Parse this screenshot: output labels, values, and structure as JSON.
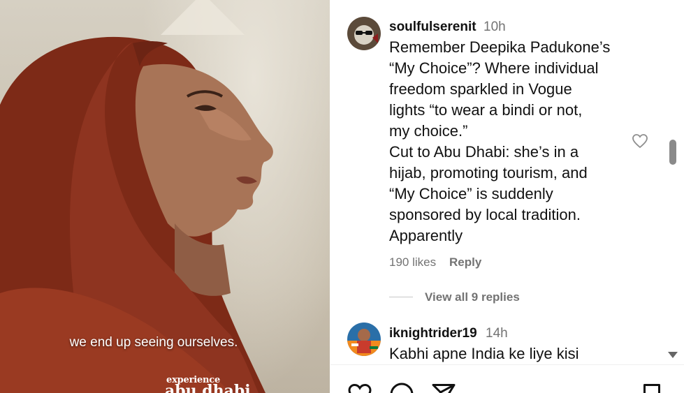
{
  "video": {
    "subtitle": "we end up seeing ourselves.",
    "brand_small": "experience",
    "brand_large": "abu dhabi"
  },
  "comments": [
    {
      "username": "soulfulserenit",
      "time": "10h",
      "text": "Remember Deepika Padukone’s\n“My Choice”? Where individual\nfreedom sparkled in Vogue\nlights “to wear a bindi or not,\nmy choice.”\nCut to Abu Dhabi: she’s in a\nhijab, promoting tourism, and\n“My Choice” is suddenly\nsponsored by local tradition.\nApparently",
      "likes": "190 likes",
      "reply_label": "Reply",
      "view_replies": "View all 9 replies"
    },
    {
      "username": "iknightrider19",
      "time": "14h",
      "text": "Kabhi apne India ke liye kisi"
    }
  ],
  "icons": {
    "like": "heart-icon",
    "comment": "comment-icon",
    "share": "send-icon",
    "save": "bookmark-icon"
  },
  "colors": {
    "text": "#111111",
    "muted": "#737373",
    "headscarf": "#8a2e1a"
  }
}
